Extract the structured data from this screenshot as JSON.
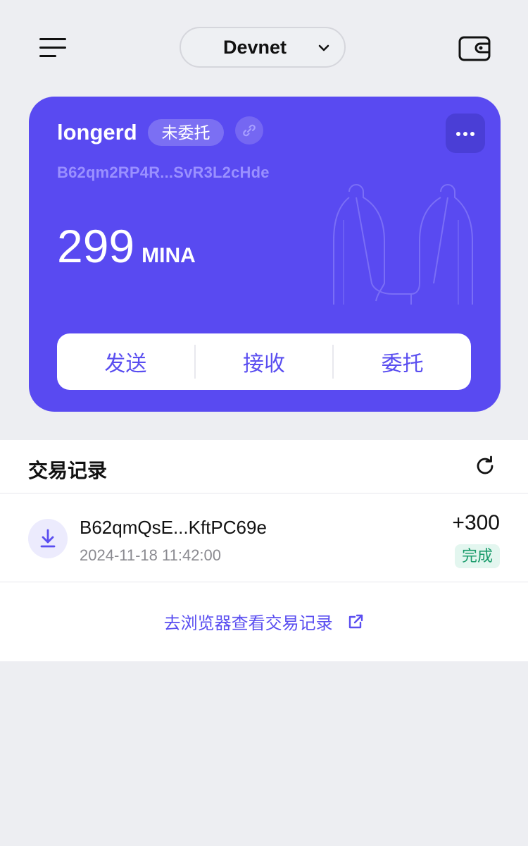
{
  "header": {
    "network_label": "Devnet"
  },
  "account": {
    "name": "longerd",
    "status_badge": "未委托",
    "address": "B62qm2RP4R...SvR3L2cHde",
    "balance": "299",
    "unit": "MINA"
  },
  "actions": {
    "send": "发送",
    "receive": "接收",
    "delegate": "委托"
  },
  "transactions": {
    "title": "交易记录",
    "items": [
      {
        "address": "B62qmQsE...KftPC69e",
        "time": "2024-11-18 11:42:00",
        "amount": "+300",
        "status": "完成",
        "icon": "download-icon"
      }
    ],
    "explorer_link": "去浏览器查看交易记录"
  },
  "colors": {
    "accent": "#594af1",
    "page_bg": "#edeef2",
    "success": "#1a9c6b"
  }
}
